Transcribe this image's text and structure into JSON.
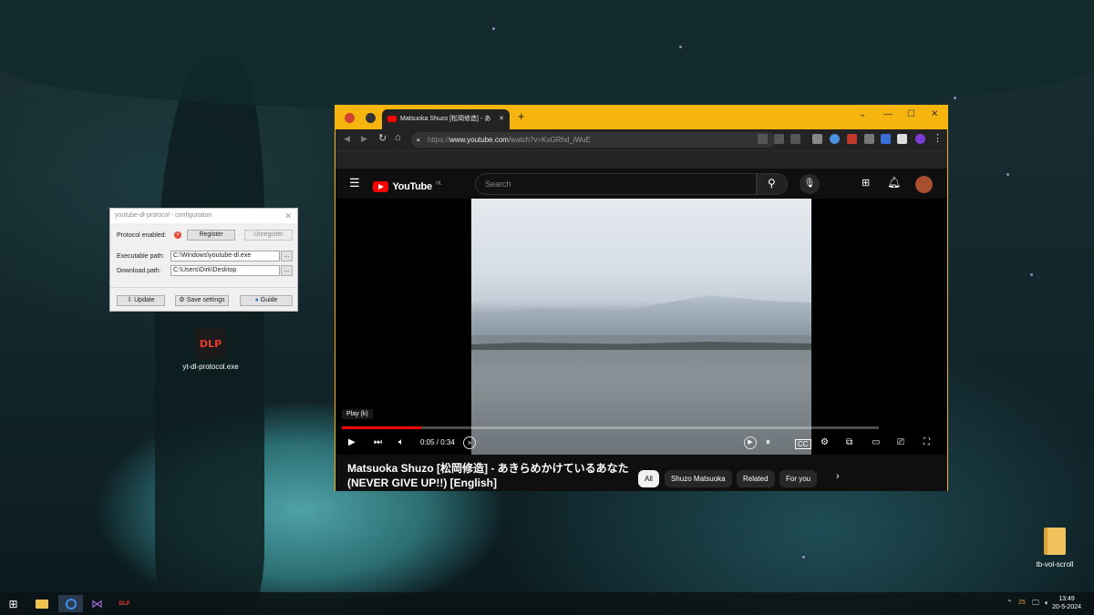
{
  "desktop": {
    "icons": [
      {
        "label": "yt-dl-protocol.exe",
        "badge": "DLP"
      },
      {
        "label": "tb-vol-scroll"
      }
    ]
  },
  "config_dialog": {
    "title": "youtube-dl-protocol - configuration",
    "protocol_label": "Protocol enabled:",
    "register_label": "Register",
    "unregister_label": "Unregister",
    "executable_label": "Executable path:",
    "executable_value": "C:\\Windows\\youtube-dl.exe",
    "download_label": "Download path:",
    "download_value": "C:\\Users\\Dirk\\Desktop",
    "browse_label": "...",
    "update_label": "Update",
    "save_label": "Save settings",
    "guide_label": "Guide"
  },
  "browser": {
    "tab_title": "Matsuoka Shuzo [松岡修造] - あ",
    "url_prefix": "https://",
    "url_host": "www.youtube.com",
    "url_path": "/watch?v=KxGRhd_iWuE",
    "new_tab_label": "+"
  },
  "youtube": {
    "logo_text": "YouTube",
    "logo_region": "NL",
    "search_placeholder": "Search",
    "tooltip": "Play (k)",
    "time_current": "0:05",
    "time_total": "0:34",
    "progress_fraction": 0.147,
    "video_title": "Matsuoka Shuzo [松岡修造] - あきらめかけているあなた (NEVER GIVE UP!!) [English]",
    "chips": [
      "All",
      "Shuzo Matsuoka",
      "Related",
      "For you"
    ]
  },
  "taskbar": {
    "tray_number": "25",
    "time": "13:49",
    "date": "20-5-2024",
    "dlp_label": "DLP"
  },
  "colors": {
    "browser_accent": "#f6b50e",
    "youtube_red": "#ff0000",
    "progress_red": "#ff0000"
  }
}
